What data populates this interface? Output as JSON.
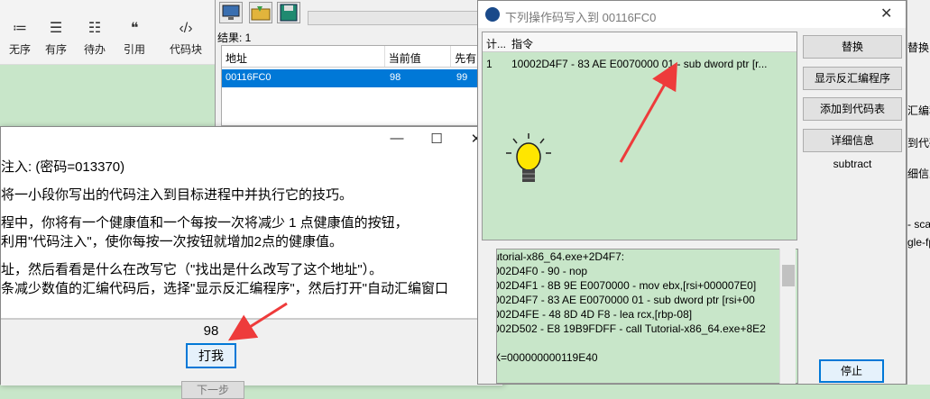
{
  "editor_toolbar": {
    "buttons": [
      {
        "icon": "unordered-list-icon",
        "glyph": "≔",
        "label": "无序"
      },
      {
        "icon": "ordered-list-icon",
        "glyph": "☰",
        "label": "有序"
      },
      {
        "icon": "todo-list-icon",
        "glyph": "☷",
        "label": "待办"
      },
      {
        "icon": "quote-icon",
        "glyph": "❝",
        "label": "引用"
      },
      {
        "icon": "code-block-icon",
        "glyph": "‹/›",
        "label": "代码块"
      }
    ]
  },
  "cheat_engine": {
    "result_label": "结果: 1",
    "columns": [
      "地址",
      "当前值",
      "先有"
    ],
    "rows": [
      {
        "address": "00116FC0",
        "current": "98",
        "previous": "99"
      }
    ]
  },
  "tutorial": {
    "controls": {
      "minimize": "—",
      "maximize": "☐",
      "close": "✕"
    },
    "lines": [
      "注入: (密码=013370)",
      "将一小段你写出的代码注入到目标进程中并执行它的技巧。",
      "程中，你将有一个健康值和一个每按一次将减少 1 点健康值的按钮，",
      "利用\"代码注入\"，使你每按一次按钮就增加2点的健康值。",
      "址，然后看看是什么在改写它（\"找出是什么改写了这个地址\"）。",
      "条减少数值的汇编代码后，选择\"显示反汇编程序\"，然后打开\"自动汇编窗口"
    ],
    "health_value": "98",
    "hit_button": "打我",
    "next_button": "下一步"
  },
  "opcode_window": {
    "title": "下列操作码写入到 00116FC0",
    "close": "✕",
    "columns": [
      "计...",
      "指令"
    ],
    "rows": [
      {
        "count": "1",
        "instruction": "10002D4F7 - 83 AE E0070000 01 - sub dword ptr [r..."
      }
    ],
    "buttons": [
      "替换",
      "显示反汇编程序",
      "添加到代码表",
      "详细信息"
    ],
    "subtract_label": "subtract",
    "disasm_lines": [
      "utorial-x86_64.exe+2D4F7:",
      "002D4F0 - 90 - nop",
      "002D4F1 - 8B 9E E0070000  - mov ebx,[rsi+000007E0]",
      "002D4F7 - 83 AE E0070000 01 - sub dword ptr [rsi+00",
      "002D4FE - 48 8D 4D F8  - lea rcx,[rbp-08]",
      "002D502 - E8 19B9FDFF - call Tutorial-x86_64.exe+8E2",
      "",
      "X=000000000119E40"
    ],
    "stop_button": "停止"
  },
  "right_panel": {
    "items": [
      "替换",
      "汇编程",
      "到代码",
      "细信息",
      "- scal",
      "gle-fp"
    ]
  },
  "colors": {
    "ce_list_bg": "#c8e6c9",
    "selection": "#0078d7",
    "annotation_arrow": "#ee3b3b"
  }
}
